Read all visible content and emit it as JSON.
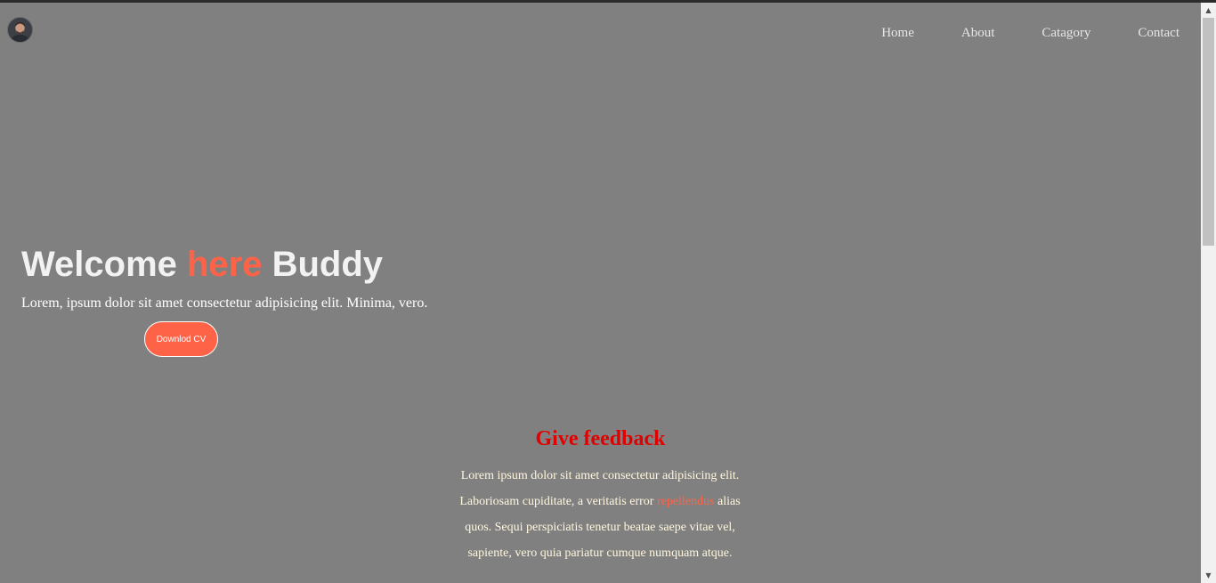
{
  "nav": {
    "items": [
      {
        "label": "Home"
      },
      {
        "label": "About"
      },
      {
        "label": "Catagory"
      },
      {
        "label": "Contact"
      }
    ]
  },
  "hero": {
    "title_part1": "Welcome ",
    "title_accent": "here",
    "title_part2": " Buddy",
    "subtitle": "Lorem, ipsum dolor sit amet consectetur adipisicing elit. Minima, vero.",
    "cv_button": "Downlod CV"
  },
  "feedback": {
    "title": "Give feedback",
    "text_before": "Lorem ipsum dolor sit amet consectetur adipisicing elit. Laboriosam cupiditate, a veritatis error ",
    "text_highlight": "repellendus",
    "text_after": " alias quos. Sequi perspiciatis tenetur beatae saepe vitae vel, sapiente, vero quia pariatur cumque numquam atque."
  },
  "colors": {
    "background": "#808080",
    "accent": "#ff6347",
    "feedback_title": "#e00000"
  },
  "icons": {
    "scroll_up": "scroll-up-arrow-icon",
    "scroll_down": "scroll-down-arrow-icon"
  }
}
